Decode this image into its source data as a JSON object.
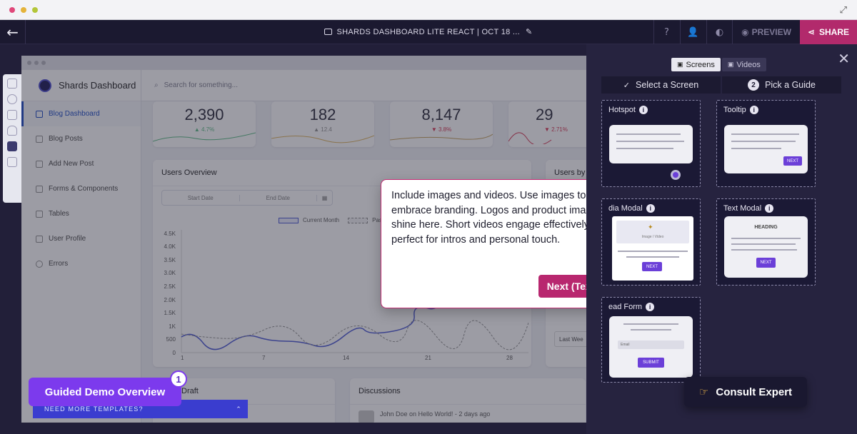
{
  "window": {
    "dot_colors": [
      "#e0487a",
      "#e5b43b",
      "#b4c63a"
    ],
    "expand_icon": "expand-icon"
  },
  "topbar": {
    "title": "SHARDS DASHBOARD LITE REACT | OCT 18 ...",
    "preview_label": "PREVIEW",
    "share_label": "SHARE"
  },
  "dashboard": {
    "brand": "Shards Dashboard",
    "search_placeholder": "Search for something...",
    "nav": [
      "Blog Dashboard",
      "Blog Posts",
      "Add New Post",
      "Forms & Components",
      "Tables",
      "User Profile",
      "Errors"
    ],
    "stats": [
      {
        "value": "2,390",
        "delta": "4.7%",
        "dir": "up"
      },
      {
        "value": "182",
        "delta": "12.4",
        "dir": "up"
      },
      {
        "value": "8,147",
        "delta": "3.8%",
        "dir": "down"
      },
      {
        "value": "29",
        "delta": "2.71%",
        "dir": "down"
      }
    ],
    "users_overview": {
      "title": "Users Overview",
      "start_date": "Start Date",
      "end_date": "End Date",
      "legend_current": "Current Month",
      "legend_past": "Past",
      "y_ticks": [
        "4.5K",
        "4.0K",
        "3.5K",
        "3.0K",
        "2.5K",
        "2.0K",
        "1.5K",
        "1K",
        "500",
        "0"
      ],
      "x_ticks": [
        "1",
        "7",
        "14",
        "21",
        "28"
      ]
    },
    "users_by_title": "Users by",
    "last_week": "Last Wee",
    "draft_title": "Draft",
    "discussions_title": "Discussions",
    "discussion_snippet": "John Doe on Hello World! - 2 days ago",
    "more_templates": "NEED MORE TEMPLATES?"
  },
  "tooltip": {
    "text": "Include images and videos. Use images to embrace branding. Logos and product images shine here. Short videos engage effectively, perfect for intros and personal touch.",
    "next_label": "Next (Text)"
  },
  "panel": {
    "tab_screens": "Screens",
    "tab_videos": "Videos",
    "step1": "Select a Screen",
    "step2_num": "2",
    "step2": "Pick a Guide",
    "cards": {
      "hotspot": "Hotspot",
      "tooltip": "Tooltip",
      "media_modal": "dia Modal",
      "text_modal": "Text Modal",
      "lead_form": "ead Form"
    },
    "mock_next": "NEXT",
    "mock_image_video": "Image / Video",
    "mock_heading": "HEADING",
    "mock_email": "Email",
    "mock_submit": "SUBMIT"
  },
  "consult_label": "Consult Expert",
  "guided": {
    "label": "Guided Demo Overview",
    "badge": "1"
  },
  "colors": {
    "brand_pink": "#b8276f",
    "purple": "#7c3aed",
    "dark": "#1f1c35"
  }
}
